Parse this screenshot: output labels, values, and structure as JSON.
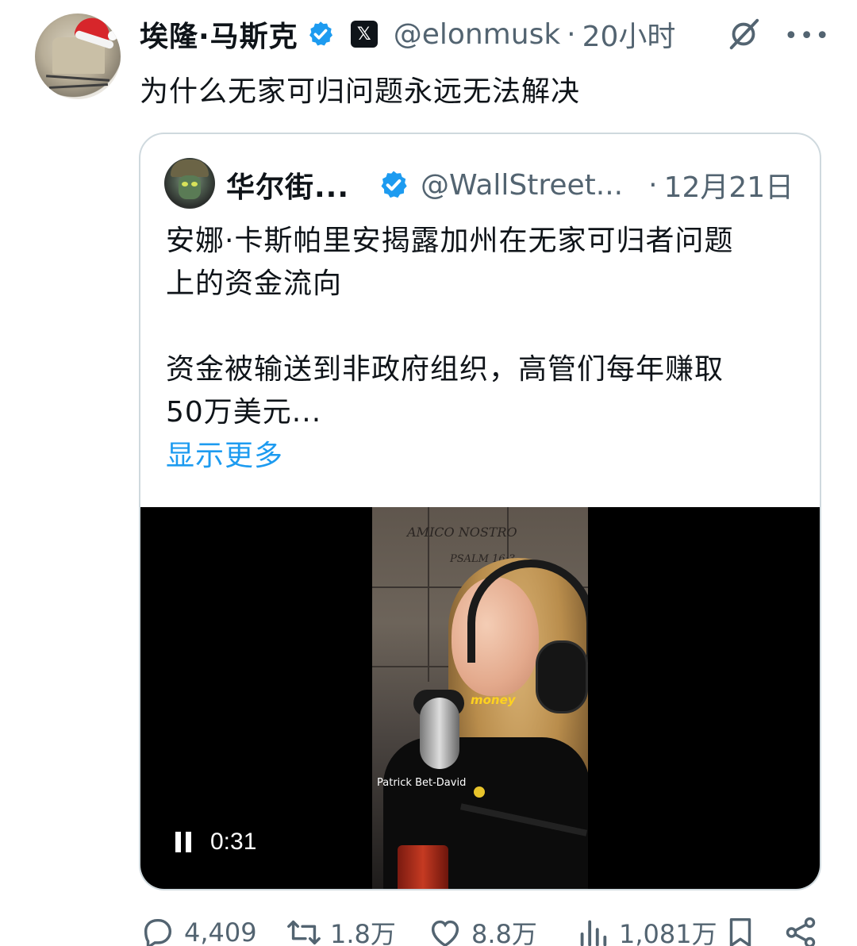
{
  "tweet": {
    "author_name": "埃隆·马斯克",
    "handle": "@elonmusk",
    "separator": "·",
    "time": "20小时",
    "x_badge": "𝕏",
    "more": "•••",
    "text": "为什么无家可归问题永远无法解决",
    "icons": {
      "verified": "verified-badge-icon",
      "grok": "grok-icon",
      "more": "more-icon"
    }
  },
  "quote": {
    "author_name": "华尔街...",
    "handle": "@WallStreet...",
    "separator": "·",
    "date": "12月21日",
    "lines": [
      "安娜·卡斯帕里安揭露加州在无家可归者问题",
      "上的资金流向",
      "资金被输送到非政府组织，高管们每年赚取",
      "50万美元..."
    ],
    "show_more": "显示更多",
    "video": {
      "duration": "0:31",
      "sign_text": "AMICO NOSTRO",
      "sign_text2": "PSALM 16:3",
      "caption": "money",
      "speaker_tag": "Patrick Bet-David",
      "state": "playing"
    }
  },
  "actions": {
    "replies": "4,409",
    "retweets": "1.8万",
    "likes": "8.8万",
    "views": "1,081万",
    "icons": [
      "reply-icon",
      "retweet-icon",
      "like-icon",
      "views-icon",
      "bookmark-icon",
      "share-icon"
    ]
  },
  "colors": {
    "text_primary": "#0f1419",
    "text_secondary": "#536471",
    "accent_link": "#1d9bf0",
    "verified_badge": "#1d9bf0",
    "card_border": "#cfd9de",
    "video_bg": "#000000"
  }
}
